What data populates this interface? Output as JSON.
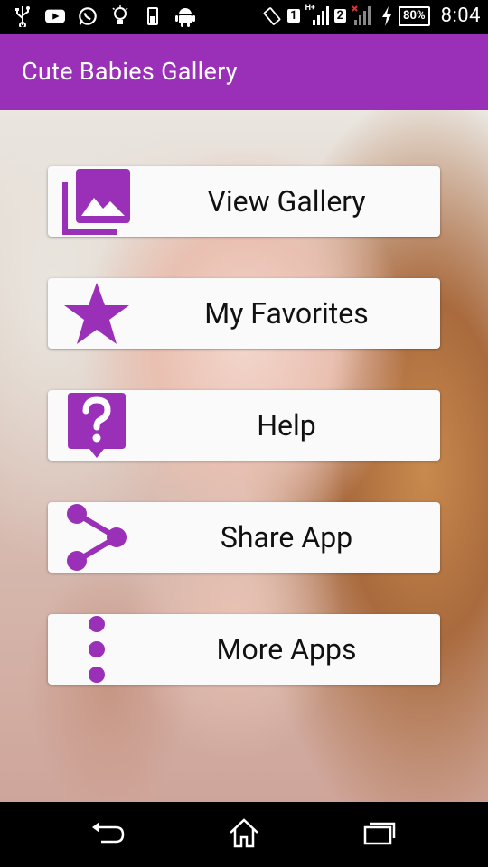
{
  "status_bar": {
    "left_icons": [
      "usb-icon",
      "youtube-icon",
      "whatsapp-icon",
      "bulb-icon",
      "phone-charging-icon",
      "android-icon"
    ],
    "sim1": "1",
    "sim2": "2",
    "network_type": "H+",
    "battery": "80%",
    "time": "8:04"
  },
  "app_bar": {
    "title": "Cute Babies Gallery",
    "color": "#9a2fb8"
  },
  "menu": [
    {
      "label": "View Gallery",
      "icon": "gallery-icon"
    },
    {
      "label": "My Favorites",
      "icon": "star-icon"
    },
    {
      "label": "Help",
      "icon": "help-icon"
    },
    {
      "label": "Share App",
      "icon": "share-icon"
    },
    {
      "label": "More Apps",
      "icon": "more-vert-icon"
    }
  ],
  "accent_color": "#9a2fb8",
  "nav_bar": {
    "buttons": [
      "back-icon",
      "home-icon",
      "recents-icon"
    ]
  }
}
